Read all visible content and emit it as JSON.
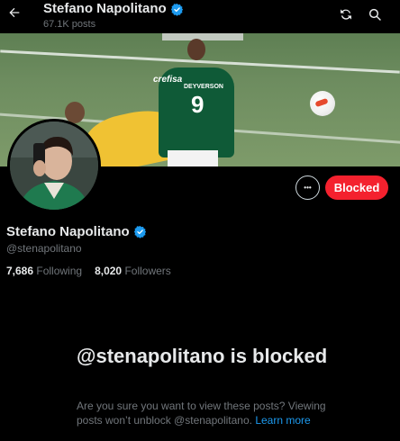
{
  "header": {
    "name": "Stefano Napolitano",
    "posts_count": "67.1K posts"
  },
  "profile": {
    "name": "Stefano Napolitano",
    "handle": "@stenapolitano",
    "following_count": "7,686",
    "following_label": "Following",
    "followers_count": "8,020",
    "followers_label": "Followers"
  },
  "actions": {
    "more_label": "•••",
    "blocked_label": "Blocked"
  },
  "banner": {
    "jersey_text": "crefisa",
    "jersey_name": "DEYVERSON",
    "jersey_number": "9"
  },
  "blocked_notice": {
    "title": "@stenapolitano is blocked",
    "body": "Are you sure you want to view these posts? Viewing posts won’t unblock @stenapolitano.",
    "link": "Learn more"
  },
  "colors": {
    "accent": "#1d9bf0",
    "blocked": "#f4212e",
    "background": "#000000",
    "muted_text": "#71767b"
  },
  "icons": [
    "back-arrow-icon",
    "verified-badge-icon",
    "refresh-icon",
    "search-icon",
    "more-icon"
  ]
}
